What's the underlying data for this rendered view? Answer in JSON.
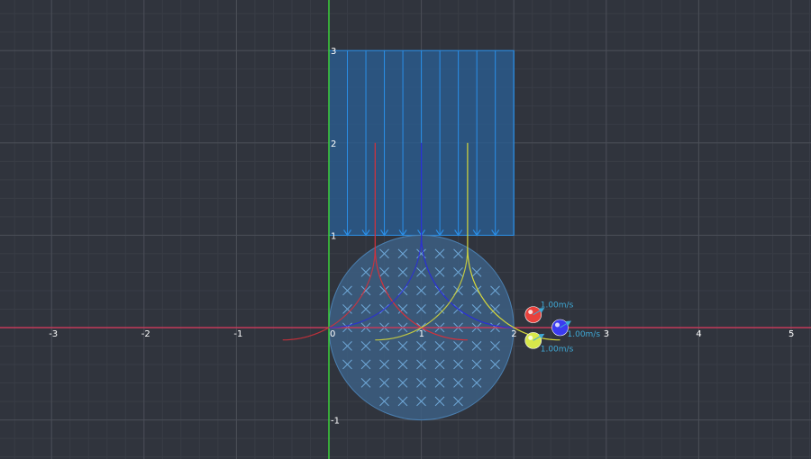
{
  "axes": {
    "x_ticks": [
      "-3",
      "-2",
      "-1",
      "0",
      "1",
      "2",
      "3",
      "4",
      "5"
    ],
    "y_ticks": [
      "-1",
      "1",
      "2",
      "3"
    ],
    "colors": {
      "background": "#30343d",
      "grid_major": "#4a4e57",
      "grid_minor": "#393d46",
      "x_axis": "#c23a5a",
      "y_axis": "#3ad13a"
    }
  },
  "electric_field": {
    "x_range": [
      0,
      2
    ],
    "y_range": [
      1,
      3
    ],
    "arrow_count": 10,
    "direction": "down",
    "color": "#2a8fe8",
    "fill": "#2a5f96"
  },
  "magnetic_field": {
    "center": [
      1,
      0
    ],
    "radius": 1,
    "direction": "into-page",
    "color": "#4a7fb0",
    "symbol_color": "#6fa8d8"
  },
  "particles": [
    {
      "name": "red",
      "color": "#e8413c",
      "velocity": "1.00m/s",
      "position": [
        2.21,
        0.14
      ]
    },
    {
      "name": "blue",
      "color": "#3b3bf0",
      "velocity": "1.00m/s",
      "position": [
        2.5,
        0.0
      ]
    },
    {
      "name": "yellow",
      "color": "#d7e84a",
      "velocity": "1.00m/s",
      "position": [
        2.21,
        -0.14
      ]
    }
  ],
  "trajectories": [
    {
      "name": "red-trajectory",
      "color": "#d6303a",
      "x_line": 0.5
    },
    {
      "name": "blue-trajectory",
      "color": "#2a2ed8",
      "x_line": 1.0
    },
    {
      "name": "yellow-trajectory",
      "color": "#d7d93a",
      "x_line": 1.5
    }
  ]
}
